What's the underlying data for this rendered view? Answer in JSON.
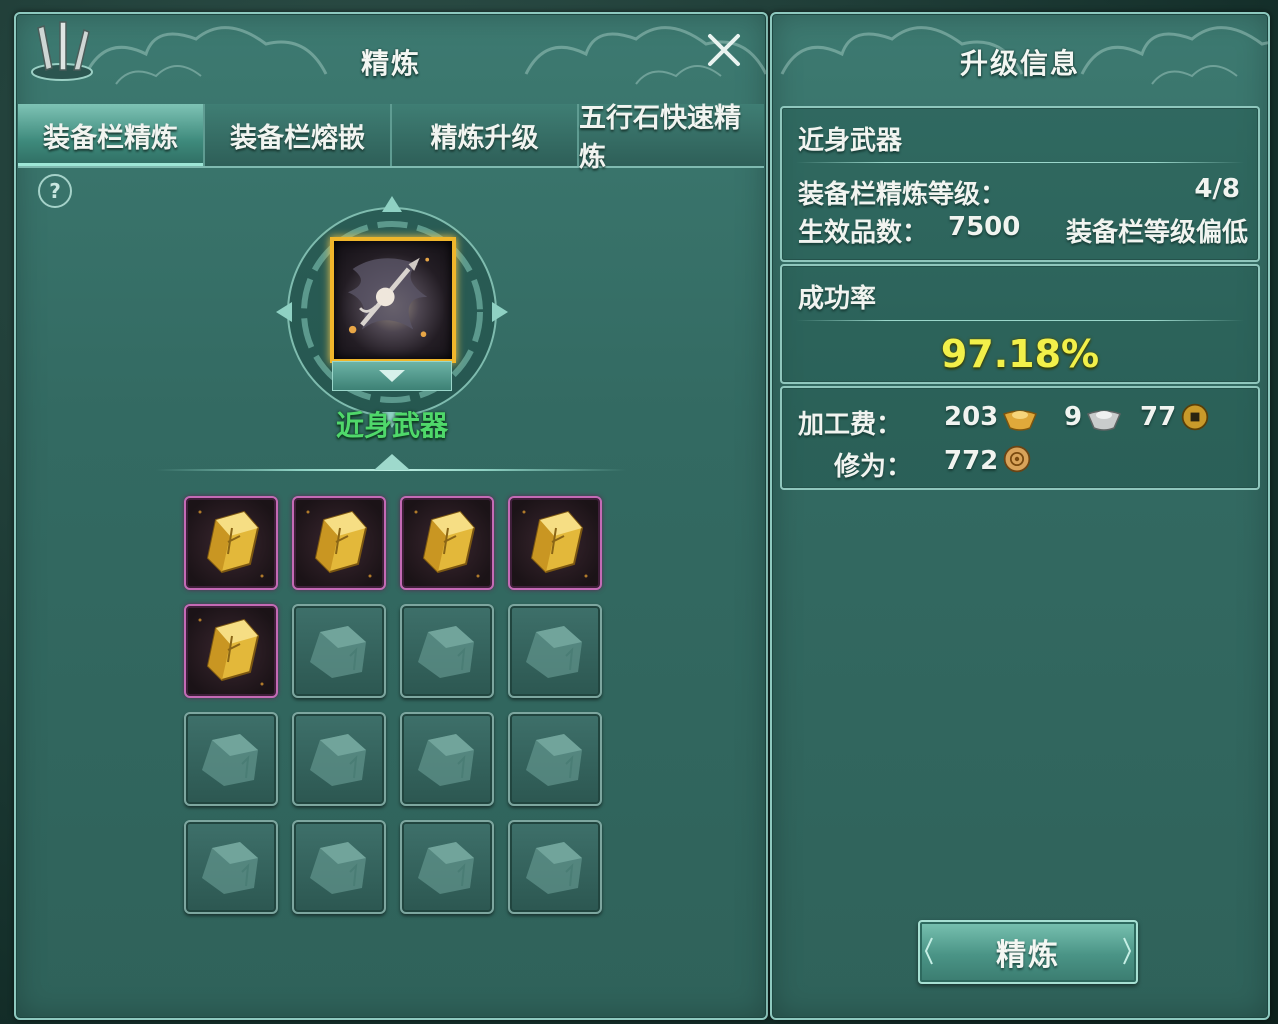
{
  "refine_panel": {
    "title": "精炼",
    "tabs": [
      {
        "label": "装备栏精炼",
        "active": true
      },
      {
        "label": "装备栏熔嵌",
        "active": false
      },
      {
        "label": "精炼升级",
        "active": false
      },
      {
        "label": "五行石快速精炼",
        "active": false
      }
    ],
    "help_label": "?",
    "equip_name": "近身武器",
    "slots": [
      {
        "state": "filled"
      },
      {
        "state": "filled"
      },
      {
        "state": "filled"
      },
      {
        "state": "filled"
      },
      {
        "state": "filled"
      },
      {
        "state": "empty"
      },
      {
        "state": "empty"
      },
      {
        "state": "empty"
      },
      {
        "state": "empty"
      },
      {
        "state": "empty"
      },
      {
        "state": "empty"
      },
      {
        "state": "empty"
      },
      {
        "state": "empty"
      },
      {
        "state": "empty"
      },
      {
        "state": "empty"
      },
      {
        "state": "empty"
      }
    ]
  },
  "info_panel": {
    "title": "升级信息",
    "equip": {
      "heading": "近身武器",
      "level_label": "装备栏精炼等级：",
      "level_value": "4/8",
      "quality_label": "生效品数：",
      "quality_value": "7500",
      "quality_note": "装备栏等级偏低"
    },
    "success": {
      "heading": "成功率",
      "rate": "97.18%"
    },
    "cost": {
      "fee_label": "加工费：",
      "gold": "203",
      "silver": "9",
      "copper": "77",
      "cultivation_label": "修为：",
      "cultivation": "772"
    },
    "refine_button": "精炼"
  },
  "colors": {
    "panel_bg": "#336a62",
    "panel_border": "#8ec9bf",
    "equip_name": "#4fd86a",
    "rate": "#f2f04a",
    "filled_slot_border": "#c46ab5"
  },
  "icons": {
    "close": "close-icon",
    "help": "help-icon",
    "gold": "gold-ingot-icon",
    "silver": "silver-ingot-icon",
    "copper": "copper-coin-icon",
    "cultivation": "cultivation-orb-icon"
  }
}
